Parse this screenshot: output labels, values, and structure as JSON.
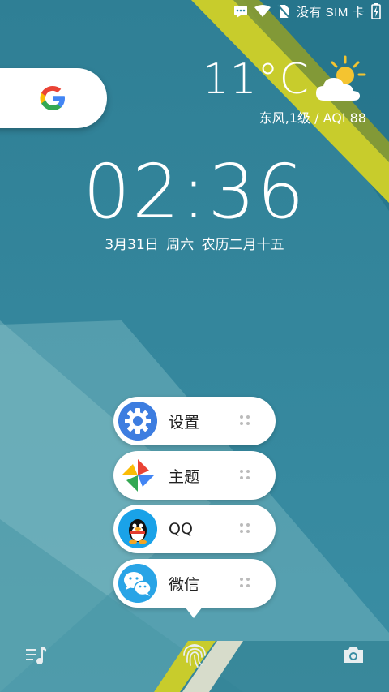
{
  "status_bar": {
    "carrier": "没有 SIM 卡",
    "icons": [
      "message-icon",
      "wifi-icon",
      "no-sim-icon",
      "battery-charging-icon"
    ]
  },
  "weather": {
    "temperature": "11°C",
    "detail": "东风,1级 / AQI 88",
    "icon": "partly-cloudy-icon"
  },
  "clock": {
    "time": "02:36"
  },
  "date": {
    "text": "3月31日  周六  农历二月十五"
  },
  "shortcuts": [
    {
      "label": "设置",
      "icon": "settings-gear-icon"
    },
    {
      "label": "主题",
      "icon": "theme-pinwheel-icon"
    },
    {
      "label": "QQ",
      "icon": "qq-penguin-icon"
    },
    {
      "label": "微信",
      "icon": "wechat-icon"
    }
  ],
  "bottom_bar": {
    "left": "music-icon",
    "center": "fingerprint-icon",
    "right": "camera-icon"
  },
  "colors": {
    "background_top": "#2f8aa0",
    "background_bottom": "#3f95a8",
    "accent_stripe": "#c7cc2a",
    "settings_blue": "#3d7de0"
  }
}
